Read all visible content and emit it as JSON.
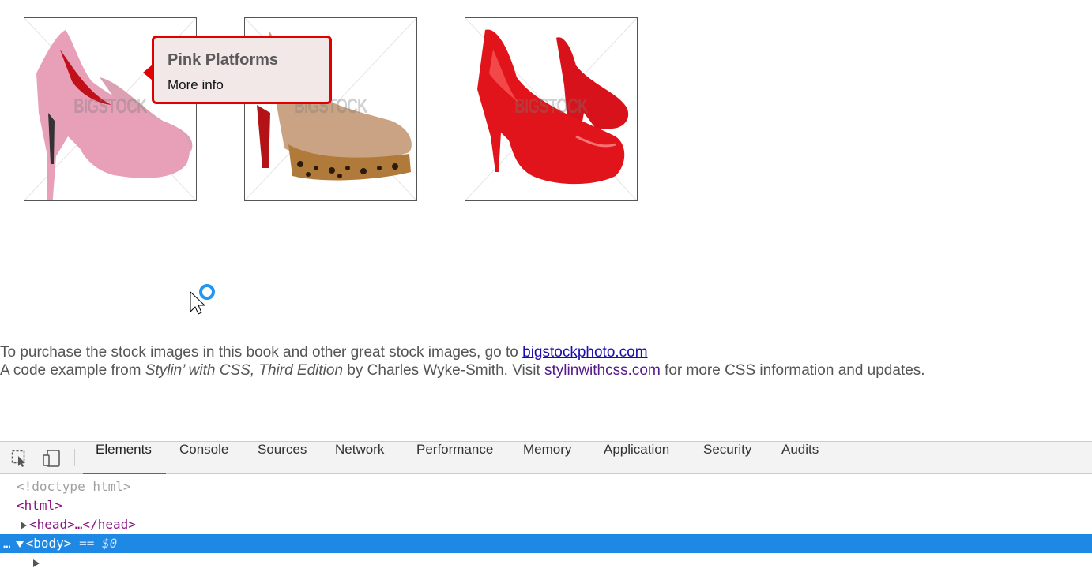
{
  "gallery": {
    "watermark": "BIGSTOCK",
    "items": [
      {
        "alt": "pink glitter platform pumps",
        "color": "#e8a0b8"
      },
      {
        "alt": "tan leopard platform pumps",
        "color": "#c9a383"
      },
      {
        "alt": "red patent platform pumps",
        "color": "#e0141a"
      }
    ]
  },
  "tooltip": {
    "title": "Pink Platforms",
    "link": "More info",
    "border_color": "#e00000"
  },
  "footer": {
    "line1_text": "To purchase the stock images in this book and other great stock images, go to ",
    "line1_link": "bigstockphoto.com",
    "line2_prefix": "A code example from ",
    "line2_book": "Stylin’ with CSS, Third Edition",
    "line2_middle": " by Charles Wyke-Smith. Visit ",
    "line2_link": "stylinwithcss.com",
    "line2_suffix": " for more CSS information and updates."
  },
  "devtools": {
    "tabs": [
      "Elements",
      "Console",
      "Sources",
      "Network",
      "Performance",
      "Memory",
      "Application",
      "Security",
      "Audits"
    ],
    "active_tab": "Elements",
    "icons": [
      "inspect-element-icon",
      "device-toolbar-icon"
    ],
    "dom": {
      "doctype": "<!doctype html>",
      "html_open": "<html>",
      "head": "<head>…</head>",
      "body": "<body>",
      "body_marker": "== $0",
      "dots": "…"
    }
  }
}
